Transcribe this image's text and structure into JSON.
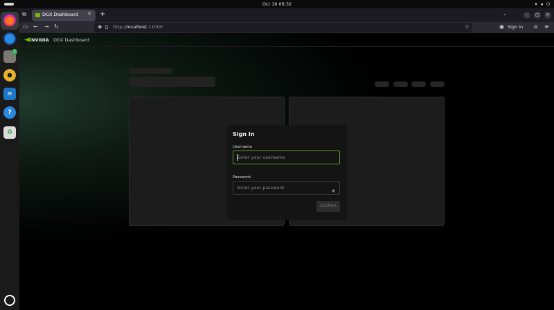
{
  "system_bar": {
    "clock": "Oct 16  06:32"
  },
  "dock": {
    "files_badge": "2"
  },
  "browser": {
    "tab_title": "DGX Dashboard",
    "url_scheme": "http://",
    "url_host": "localhost",
    "url_port": ":11000",
    "signin_label": "Sign in"
  },
  "app": {
    "brand": "NVIDIA",
    "title": "DGX Dashboard"
  },
  "login": {
    "title": "Sign In",
    "username_label": "Username",
    "username_placeholder": "Enter your username",
    "password_label": "Password",
    "password_placeholder": "Enter your password",
    "confirm_label": "Confirm"
  },
  "colors": {
    "accent": "#76b900",
    "focus_border": "#5e9c1e"
  }
}
